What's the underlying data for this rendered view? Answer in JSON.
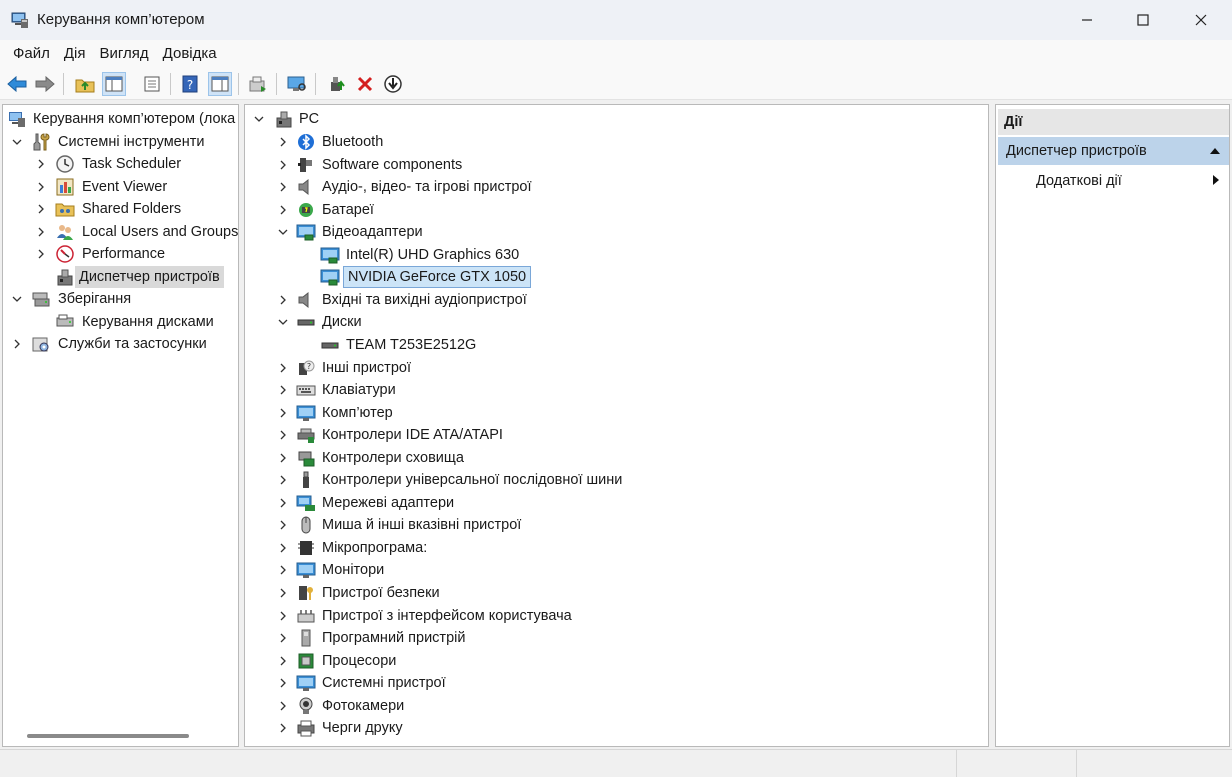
{
  "window": {
    "title": "Керування комп’ютером"
  },
  "menu": [
    "Файл",
    "Дія",
    "Вигляд",
    "Довідка"
  ],
  "tree": {
    "root_label": "Керування комп’ютером (лока",
    "system_tools_label": "Системні інструменти",
    "items": [
      "Task Scheduler",
      "Event Viewer",
      "Shared Folders",
      "Local Users and Groups",
      "Performance",
      "Диспетчер пристроїв"
    ],
    "storage_label": "Зберігання",
    "storage_items": [
      "Керування дисками"
    ],
    "services_label": "Служби та застосунки"
  },
  "devices": {
    "root": "PC",
    "categories": [
      {
        "label": "Bluetooth",
        "icon": "bluetooth-icon"
      },
      {
        "label": "Software components",
        "icon": "software-components-icon"
      },
      {
        "label": "Аудіо-, відео- та ігрові пристрої",
        "icon": "speaker-icon"
      },
      {
        "label": "Батареї",
        "icon": "battery-icon"
      },
      {
        "label": "Відеоадаптери",
        "icon": "display-adapter-icon"
      },
      {
        "label": "Intel(R) UHD Graphics 630",
        "icon": "display-adapter-icon"
      },
      {
        "label": "NVIDIA GeForce GTX 1050",
        "icon": "display-adapter-icon"
      },
      {
        "label": "Вхідні та вихідні аудіопристрої",
        "icon": "speaker-icon"
      },
      {
        "label": "Диски",
        "icon": "disk-drive-icon"
      },
      {
        "label": "TEAM T253E2512G",
        "icon": "disk-drive-icon"
      },
      {
        "label": "Інші пристрої",
        "icon": "unknown-device-icon"
      },
      {
        "label": "Клавіатури",
        "icon": "keyboard-icon"
      },
      {
        "label": "Комп’ютер",
        "icon": "monitor-icon"
      },
      {
        "label": "Контролери IDE ATA/ATAPI",
        "icon": "ide-controller-icon"
      },
      {
        "label": "Контролери сховища",
        "icon": "storage-controller-icon"
      },
      {
        "label": "Контролери універсальної послідовної шини",
        "icon": "usb-icon"
      },
      {
        "label": "Мережеві адаптери",
        "icon": "network-adapter-icon"
      },
      {
        "label": "Миша й інші вказівні пристрої",
        "icon": "mouse-icon"
      },
      {
        "label": "Мікропрограма:",
        "icon": "firmware-icon"
      },
      {
        "label": "Монітори",
        "icon": "monitor-icon"
      },
      {
        "label": "Пристрої безпеки",
        "icon": "security-device-icon"
      },
      {
        "label": "Пристрої з інтерфейсом користувача",
        "icon": "hid-icon"
      },
      {
        "label": "Програмний пристрій",
        "icon": "software-device-icon"
      },
      {
        "label": "Процесори",
        "icon": "processor-icon"
      },
      {
        "label": "Системні пристрої",
        "icon": "system-device-icon"
      },
      {
        "label": "Фотокамери",
        "icon": "camera-icon"
      },
      {
        "label": "Черги друку",
        "icon": "printer-icon"
      }
    ]
  },
  "actions": {
    "header": "Дії",
    "section": "Диспетчер пристроїв",
    "more": "Додаткові дії"
  },
  "colors": {
    "selection": "#cce4f7",
    "section_header": "#bcd3ea",
    "accent": "#0a64c8"
  }
}
